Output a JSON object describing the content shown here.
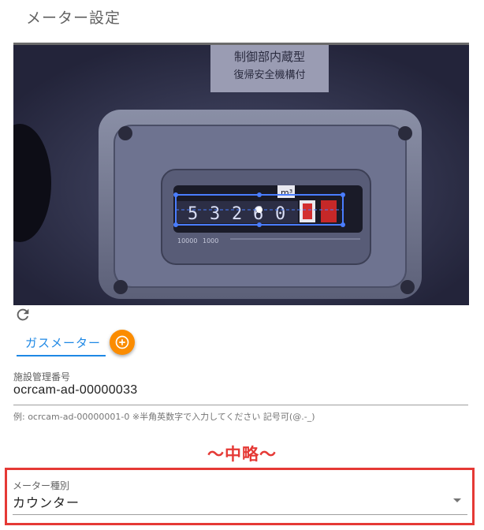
{
  "page": {
    "title": "メーター設定"
  },
  "camera": {
    "signage": [
      "制御部内蔵型",
      "復帰安全機構付"
    ],
    "digits": [
      "5",
      "3",
      "2",
      "6",
      "0"
    ],
    "unit": "m³",
    "scale": [
      "10000",
      "1000"
    ],
    "colors": {
      "roi": "#4a7dff",
      "red_digit": "#d32f2f"
    }
  },
  "tabs": [
    {
      "label": "ガスメーター",
      "active": true
    }
  ],
  "facility": {
    "label": "施設管理番号",
    "value": "ocrcam-ad-00000033",
    "hint": "例: ocrcam-ad-00000001-0 ※半角英数字で入力してください 記号可(@.-_)"
  },
  "omitted_text": "～中略～",
  "meter_type": {
    "label": "メーター種別",
    "value": "カウンター"
  },
  "colors": {
    "accent": "#1e88e5",
    "add_button": "#fb8c00",
    "highlight": "#e53935"
  }
}
